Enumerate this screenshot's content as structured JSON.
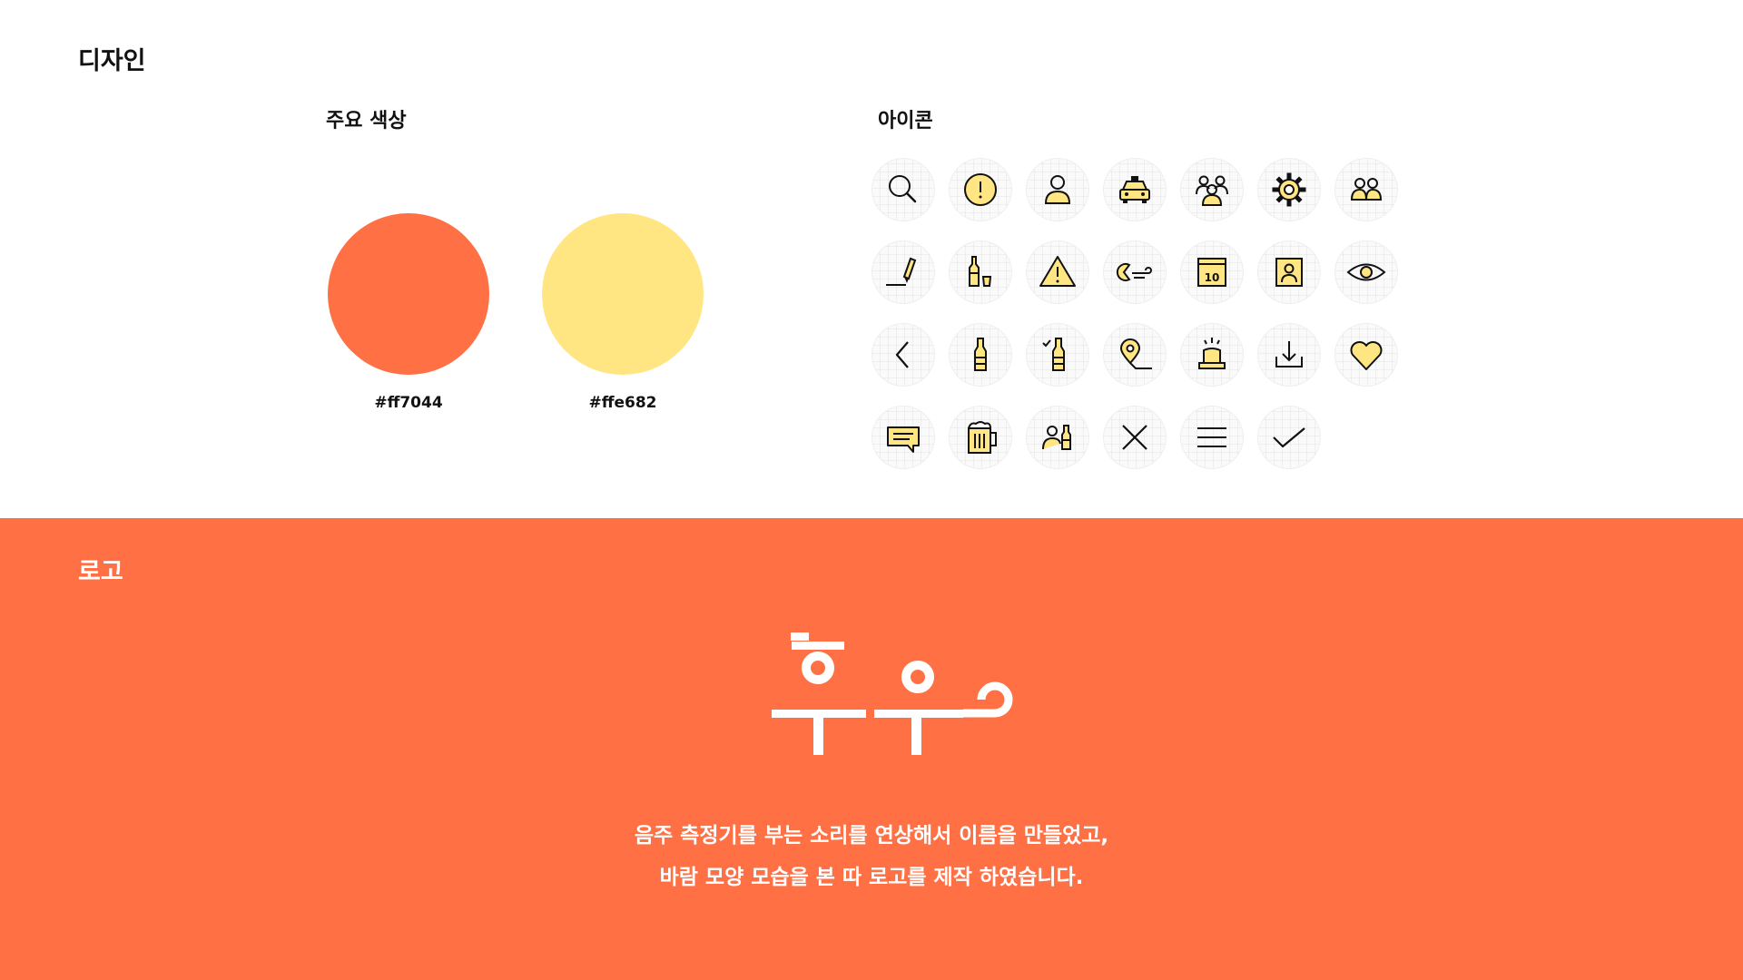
{
  "design": {
    "title": "디자인",
    "colors_title": "주요 색상",
    "icons_title": "아이콘",
    "colors": [
      {
        "hex": "#ff7044",
        "label": "#ff7044"
      },
      {
        "hex": "#ffe682",
        "label": "#ffe682"
      }
    ],
    "icons": [
      "search-icon",
      "alert-circle-icon",
      "user-icon",
      "taxi-icon",
      "group-icon",
      "settings-icon",
      "friends-icon",
      "pen-icon",
      "bottle-glass-icon",
      "warning-icon",
      "breath-icon",
      "calendar-icon",
      "profile-card-icon",
      "eye-icon",
      "chevron-left-icon",
      "bottle-icon",
      "bottle-check-icon",
      "location-pin-icon",
      "siren-icon",
      "download-icon",
      "heart-icon",
      "chat-icon",
      "beer-mug-icon",
      "person-bottle-icon",
      "close-icon",
      "menu-icon",
      "check-icon"
    ]
  },
  "logo": {
    "title": "로고",
    "brand_text": "후우",
    "description_line1": "음주 측정기를 부는 소리를 연상해서 이름을 만들었고,",
    "description_line2": "바람 모양 모습을 본 따 로고를 제작 하였습니다."
  },
  "accent_color": "#ff7044",
  "secondary_color": "#ffe682"
}
